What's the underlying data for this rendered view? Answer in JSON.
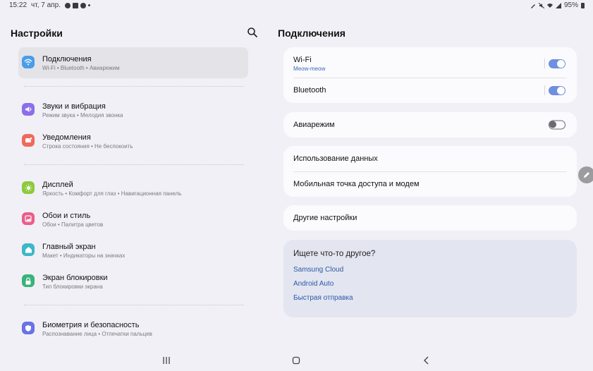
{
  "status_bar": {
    "time": "15:22",
    "date": "чт, 7 апр.",
    "battery": "95%",
    "notification_icons": [
      "chat-icon",
      "calendar-icon",
      "circle-app-icon"
    ],
    "system_icons": [
      "pen-icon",
      "mute-icon",
      "wifi-icon",
      "signal-icon"
    ]
  },
  "left_panel": {
    "title": "Настройки",
    "groups": [
      [
        {
          "title": "Подключения",
          "subtitle": "Wi-Fi  •  Bluetooth  •  Авиарежим",
          "icon": "wifi-icon",
          "color": "#4a9de8",
          "active": true
        }
      ],
      [
        {
          "title": "Звуки и вибрация",
          "subtitle": "Режим звука  •  Мелодия звонка",
          "icon": "volume-icon",
          "color": "#8b6fe8"
        },
        {
          "title": "Уведомления",
          "subtitle": "Строка состояния  •  Не беспокоить",
          "icon": "notification-icon",
          "color": "#ee6b5b"
        }
      ],
      [
        {
          "title": "Дисплей",
          "subtitle": "Яркость  •  Комфорт для глаз  •  Навигационная панель",
          "icon": "sun-icon",
          "color": "#8ccb3a"
        },
        {
          "title": "Обои и стиль",
          "subtitle": "Обои  •  Палитра цветов",
          "icon": "wallpaper-icon",
          "color": "#ea5d8a"
        },
        {
          "title": "Главный экран",
          "subtitle": "Макет  •  Индикаторы на значках",
          "icon": "home-icon",
          "color": "#3fb6c9"
        },
        {
          "title": "Экран блокировки",
          "subtitle": "Тип блокировки экрана",
          "icon": "lock-icon",
          "color": "#39b37a"
        }
      ],
      [
        {
          "title": "Биометрия и безопасность",
          "subtitle": "Распознавание лица  •  Отпечатки пальцев",
          "icon": "shield-icon",
          "color": "#6a72e6"
        }
      ]
    ]
  },
  "right_panel": {
    "title": "Подключения",
    "wifi": {
      "title": "Wi-Fi",
      "subtitle": "Meow-meow",
      "on": true
    },
    "bluetooth": {
      "title": "Bluetooth",
      "on": true
    },
    "airplane": {
      "title": "Авиарежим",
      "on": false
    },
    "data_usage": "Использование данных",
    "hotspot": "Мобильная точка доступа и модем",
    "more": "Другие настройки",
    "looking_for": {
      "heading": "Ищете что-то другое?",
      "links": [
        "Samsung Cloud",
        "Android Auto",
        "Быстрая отправка"
      ]
    }
  },
  "colors": {
    "accent": "#6f8fdf",
    "link": "#2e59a8",
    "background": "#f1f0f6"
  }
}
